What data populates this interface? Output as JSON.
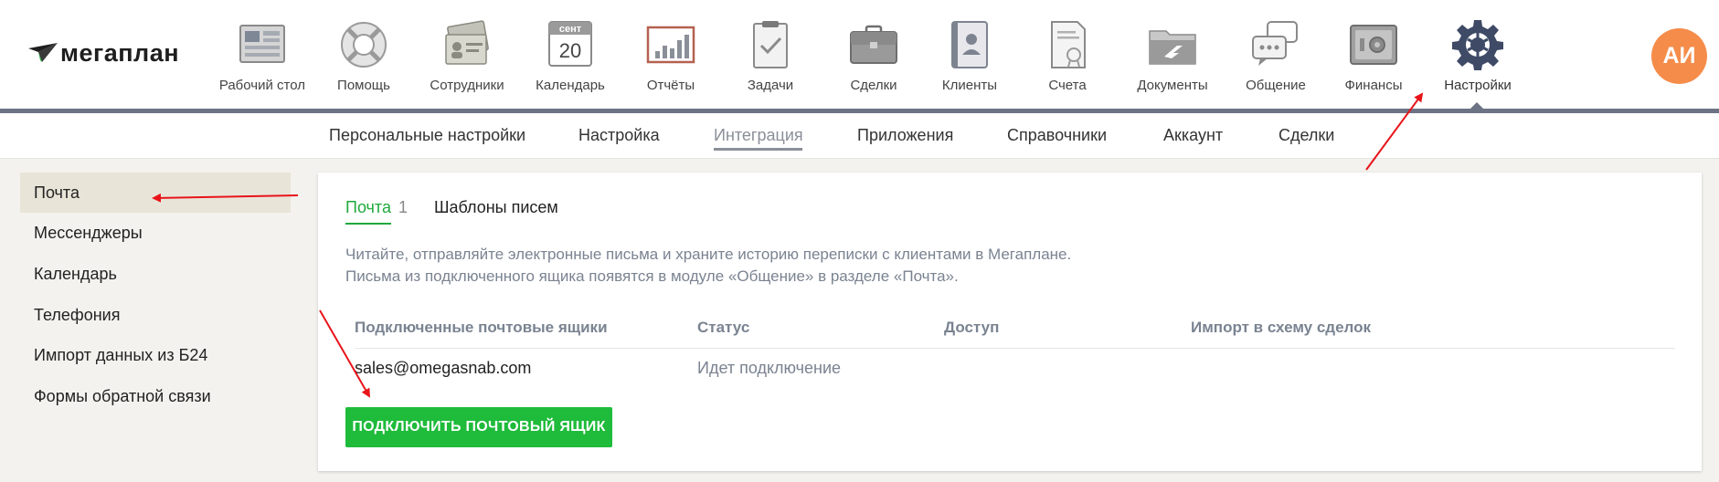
{
  "logo": {
    "text": "мегаплан"
  },
  "modules": [
    {
      "id": "desktop",
      "label": "Рабочий стол",
      "icon": "desktop-icon"
    },
    {
      "id": "help",
      "label": "Помощь",
      "icon": "lifebuoy-icon"
    },
    {
      "id": "employees",
      "label": "Сотрудники",
      "icon": "id-cards-icon"
    },
    {
      "id": "calendar",
      "label": "Календарь",
      "icon": "calendar-icon",
      "month": "сент",
      "day": "20"
    },
    {
      "id": "reports",
      "label": "Отчёты",
      "icon": "bar-chart-board-icon"
    },
    {
      "id": "tasks",
      "label": "Задачи",
      "icon": "clipboard-check-icon"
    },
    {
      "id": "deals",
      "label": "Сделки",
      "icon": "briefcase-icon"
    },
    {
      "id": "clients",
      "label": "Клиенты",
      "icon": "address-book-icon"
    },
    {
      "id": "invoices",
      "label": "Счета",
      "icon": "invoice-seal-icon"
    },
    {
      "id": "documents",
      "label": "Документы",
      "icon": "folder-icon"
    },
    {
      "id": "communication",
      "label": "Общение",
      "icon": "chat-bubbles-icon"
    },
    {
      "id": "finance",
      "label": "Финансы",
      "icon": "safe-icon"
    },
    {
      "id": "settings",
      "label": "Настройки",
      "icon": "gear-icon",
      "active": true
    }
  ],
  "user": {
    "initials": "АИ"
  },
  "subnav": [
    {
      "label": "Персональные настройки"
    },
    {
      "label": "Настройка"
    },
    {
      "label": "Интеграция",
      "active": true
    },
    {
      "label": "Приложения"
    },
    {
      "label": "Справочники"
    },
    {
      "label": "Аккаунт"
    },
    {
      "label": "Сделки"
    }
  ],
  "sidebar": [
    {
      "label": "Почта",
      "active": true
    },
    {
      "label": "Мессенджеры"
    },
    {
      "label": "Календарь"
    },
    {
      "label": "Телефония"
    },
    {
      "label": "Импорт данных из Б24"
    },
    {
      "label": "Формы обратной связи"
    }
  ],
  "content": {
    "tabs": [
      {
        "label": "Почта",
        "count": "1",
        "active": true
      },
      {
        "label": "Шаблоны писем"
      }
    ],
    "description": [
      "Читайте, отправляйте электронные письма и храните историю переписки с клиентами в Мегаплане.",
      "Письма из подключенного ящика появятся в модуле «Общение» в разделе «Почта»."
    ],
    "table": {
      "headers": [
        "Подключенные почтовые ящики",
        "Статус",
        "Доступ",
        "Импорт в схему сделок"
      ],
      "rows": [
        {
          "email": "sales@omegasnab.com",
          "status": "Идет подключение",
          "access": "",
          "import": ""
        }
      ]
    },
    "connect_button": "ПОДКЛЮЧИТЬ ПОЧТОВЫЙ ЯЩИК"
  },
  "colors": {
    "accent_green": "#1fbb3b",
    "nav_line": "#6b7384",
    "avatar": "#f58c4a",
    "annotation_arrow": "#e8141a"
  }
}
